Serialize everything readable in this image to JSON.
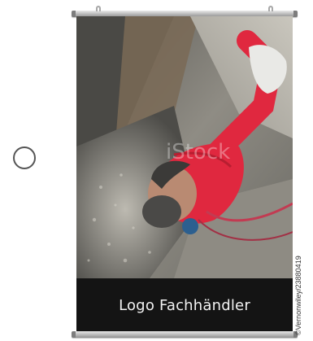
{
  "banner": {
    "logo_text": "Logo Fachhändler",
    "watermark_text": "iStock"
  },
  "credit": {
    "text": "©Vernonwiley/23880419"
  },
  "colors": {
    "logo_bar": "#141414",
    "jacket": "#e0283f",
    "rock": "#8d8a82"
  },
  "icons": {
    "radio": "circle-outline-icon"
  }
}
